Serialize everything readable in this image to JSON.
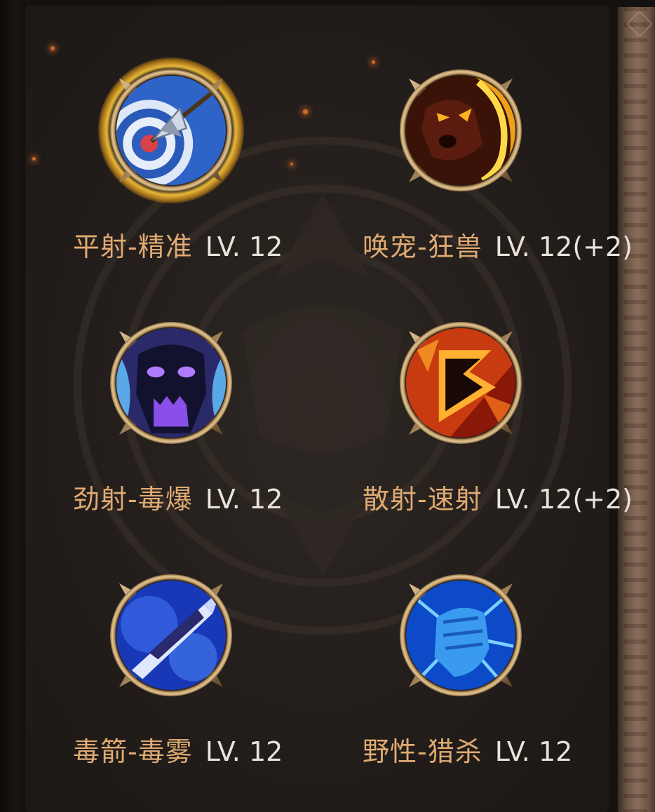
{
  "skills": [
    {
      "name": "平射-精准",
      "level": "LV. 12",
      "icon": "target-arrow-icon",
      "selected": true
    },
    {
      "name": "唤宠-狂兽",
      "level": "LV. 12(+2)",
      "icon": "fire-beast-icon",
      "selected": false
    },
    {
      "name": "劲射-毒爆",
      "level": "LV. 12",
      "icon": "purple-skull-icon",
      "selected": false
    },
    {
      "name": "散射-速射",
      "level": "LV. 12(+2)",
      "icon": "fire-arrow-icon",
      "selected": false
    },
    {
      "name": "毒箭-毒雾",
      "level": "LV. 12",
      "icon": "poison-arrow-icon",
      "selected": false
    },
    {
      "name": "野性-猎杀",
      "level": "LV. 12",
      "icon": "blue-fist-icon",
      "selected": false
    }
  ],
  "colors": {
    "skill_name": "#e0aa72",
    "level_text": "#e9e3da",
    "selected_glow": "#ffc83c"
  }
}
